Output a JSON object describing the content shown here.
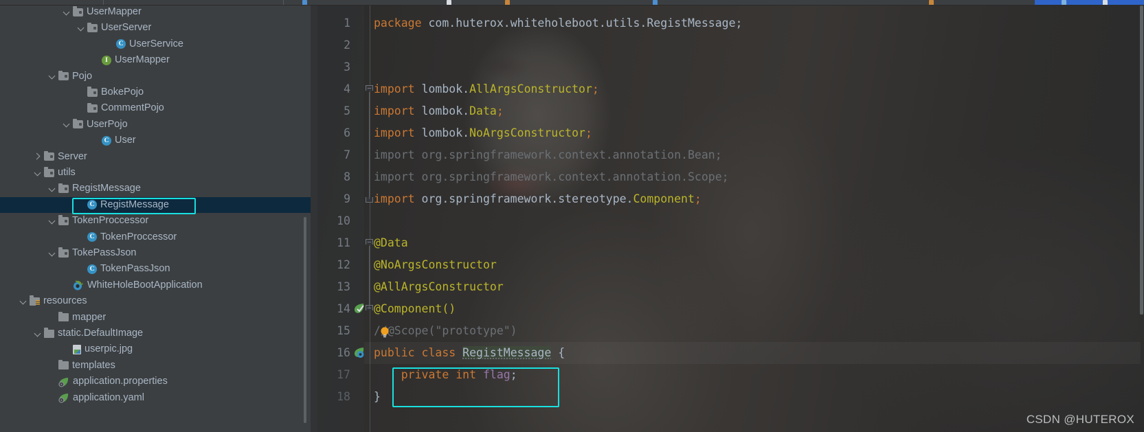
{
  "toolbar": {
    "visible_fragment": true,
    "highlight_color": "#2f65ca"
  },
  "sidebar": {
    "name": "project-tree",
    "selected_item": "RegistMessage",
    "items": [
      {
        "label": "UserMapper",
        "indent": 4,
        "arrow": "open",
        "icon": "folder"
      },
      {
        "label": "UserServer",
        "indent": 5,
        "arrow": "open",
        "icon": "folder"
      },
      {
        "label": "UserService",
        "indent": 7,
        "arrow": "none",
        "icon": "class"
      },
      {
        "label": "UserMapper",
        "indent": 6,
        "arrow": "none",
        "icon": "interface"
      },
      {
        "label": "Pojo",
        "indent": 3,
        "arrow": "open",
        "icon": "folder"
      },
      {
        "label": "BokePojo",
        "indent": 5,
        "arrow": "none",
        "icon": "folder"
      },
      {
        "label": "CommentPojo",
        "indent": 5,
        "arrow": "none",
        "icon": "folder"
      },
      {
        "label": "UserPojo",
        "indent": 4,
        "arrow": "open",
        "icon": "folder"
      },
      {
        "label": "User",
        "indent": 6,
        "arrow": "none",
        "icon": "class"
      },
      {
        "label": "Server",
        "indent": 2,
        "arrow": "closed",
        "icon": "folder"
      },
      {
        "label": "utils",
        "indent": 2,
        "arrow": "open",
        "icon": "folder"
      },
      {
        "label": "RegistMessage",
        "indent": 3,
        "arrow": "open",
        "icon": "folder"
      },
      {
        "label": "RegistMessage",
        "indent": 5,
        "arrow": "none",
        "icon": "class",
        "selected": true,
        "boxed": true
      },
      {
        "label": "TokenProccessor",
        "indent": 3,
        "arrow": "open",
        "icon": "folder"
      },
      {
        "label": "TokenProccessor",
        "indent": 5,
        "arrow": "none",
        "icon": "class"
      },
      {
        "label": "TokePassJson",
        "indent": 3,
        "arrow": "open",
        "icon": "folder"
      },
      {
        "label": "TokenPassJson",
        "indent": 5,
        "arrow": "none",
        "icon": "class"
      },
      {
        "label": "WhiteHoleBootApplication",
        "indent": 4,
        "arrow": "none",
        "icon": "spring-app"
      },
      {
        "label": "resources",
        "indent": 1,
        "arrow": "open",
        "icon": "folder-resources"
      },
      {
        "label": "mapper",
        "indent": 3,
        "arrow": "none",
        "icon": "folder-plain"
      },
      {
        "label": "static.DefaultImage",
        "indent": 2,
        "arrow": "open",
        "icon": "folder-plain"
      },
      {
        "label": "userpic.jpg",
        "indent": 4,
        "arrow": "none",
        "icon": "image-file"
      },
      {
        "label": "templates",
        "indent": 3,
        "arrow": "none",
        "icon": "folder-plain"
      },
      {
        "label": "application.properties",
        "indent": 3,
        "arrow": "none",
        "icon": "spring-leaf"
      },
      {
        "label": "application.yaml",
        "indent": 3,
        "arrow": "none",
        "icon": "spring-leaf"
      }
    ]
  },
  "editor": {
    "name": "java-code-editor",
    "file": "RegistMessage.java",
    "highlight_box_line": 17,
    "lines": [
      {
        "n": "1",
        "fold": "none",
        "tokens": [
          {
            "t": "package ",
            "c": "k"
          },
          {
            "t": "com.huterox.whiteholeboot.utils.RegistMessage;",
            "c": "s"
          }
        ]
      },
      {
        "n": "2",
        "fold": "none",
        "tokens": []
      },
      {
        "n": "3",
        "fold": "none",
        "tokens": []
      },
      {
        "n": "4",
        "fold": "start",
        "tokens": [
          {
            "t": "import ",
            "c": "k"
          },
          {
            "t": "lombok.",
            "c": "s"
          },
          {
            "t": "AllArgsConstructor",
            "c": "an"
          },
          {
            "t": ";",
            "c": "k"
          }
        ]
      },
      {
        "n": "5",
        "fold": "none",
        "tokens": [
          {
            "t": "import ",
            "c": "k"
          },
          {
            "t": "lombok.",
            "c": "s"
          },
          {
            "t": "Data",
            "c": "an"
          },
          {
            "t": ";",
            "c": "k"
          }
        ]
      },
      {
        "n": "6",
        "fold": "none",
        "tokens": [
          {
            "t": "import ",
            "c": "k"
          },
          {
            "t": "lombok.",
            "c": "s"
          },
          {
            "t": "NoArgsConstructor",
            "c": "an"
          },
          {
            "t": ";",
            "c": "k"
          }
        ]
      },
      {
        "n": "7",
        "fold": "none",
        "tokens": [
          {
            "t": "import org.springframework.context.annotation.Bean;",
            "c": "dim"
          }
        ]
      },
      {
        "n": "8",
        "fold": "none",
        "tokens": [
          {
            "t": "import org.springframework.context.annotation.Scope;",
            "c": "dim"
          }
        ]
      },
      {
        "n": "9",
        "fold": "end",
        "tokens": [
          {
            "t": "import ",
            "c": "k"
          },
          {
            "t": "org.springframework.stereotype.",
            "c": "s"
          },
          {
            "t": "Component",
            "c": "an"
          },
          {
            "t": ";",
            "c": "k"
          }
        ]
      },
      {
        "n": "10",
        "fold": "none",
        "tokens": []
      },
      {
        "n": "11",
        "fold": "start",
        "tokens": [
          {
            "t": "@Data",
            "c": "an"
          }
        ]
      },
      {
        "n": "12",
        "fold": "none",
        "tokens": [
          {
            "t": "@NoArgsConstructor",
            "c": "an"
          }
        ]
      },
      {
        "n": "13",
        "fold": "none",
        "tokens": [
          {
            "t": "@AllArgsConstructor",
            "c": "an"
          }
        ]
      },
      {
        "n": "14",
        "fold": "start",
        "gutter_icon": "spring-bean",
        "tokens": [
          {
            "t": "@Component()",
            "c": "an"
          }
        ]
      },
      {
        "n": "15",
        "fold": "none",
        "bulb": true,
        "tokens": [
          {
            "t": "//",
            "c": "cmt"
          },
          {
            "t": "@Scope(\"prototype\")",
            "c": "cmt"
          }
        ]
      },
      {
        "n": "16",
        "fold": "none",
        "gutter_icon": "spring-class",
        "row_highlight": true,
        "tokens": [
          {
            "t": "public ",
            "c": "k"
          },
          {
            "t": "class ",
            "c": "k"
          },
          {
            "t": "RegistMessage",
            "c": "cls"
          },
          {
            "t": " {",
            "c": "s"
          }
        ]
      },
      {
        "n": "17",
        "fold": "none",
        "dim_no": true,
        "tokens": [
          {
            "t": "    ",
            "c": "s"
          },
          {
            "t": "private ",
            "c": "k"
          },
          {
            "t": "int ",
            "c": "k"
          },
          {
            "t": "flag",
            "c": "fld"
          },
          {
            "t": ";",
            "c": "s"
          }
        ]
      },
      {
        "n": "18",
        "fold": "none",
        "dim_no": true,
        "tokens": [
          {
            "t": "}",
            "c": "s"
          }
        ]
      }
    ]
  },
  "watermark": {
    "text": "CSDN @HUTEROX"
  },
  "colors": {
    "accent_box": "#19e0e0",
    "selection_row": "#0d293e",
    "keyword": "#cc7832",
    "annotation": "#bbb529",
    "plain": "#a9b7c6",
    "field": "#9876aa",
    "comment": "#6b7075",
    "editor_bg": "#2b2b2b",
    "sidebar_bg": "#3c3f41"
  }
}
